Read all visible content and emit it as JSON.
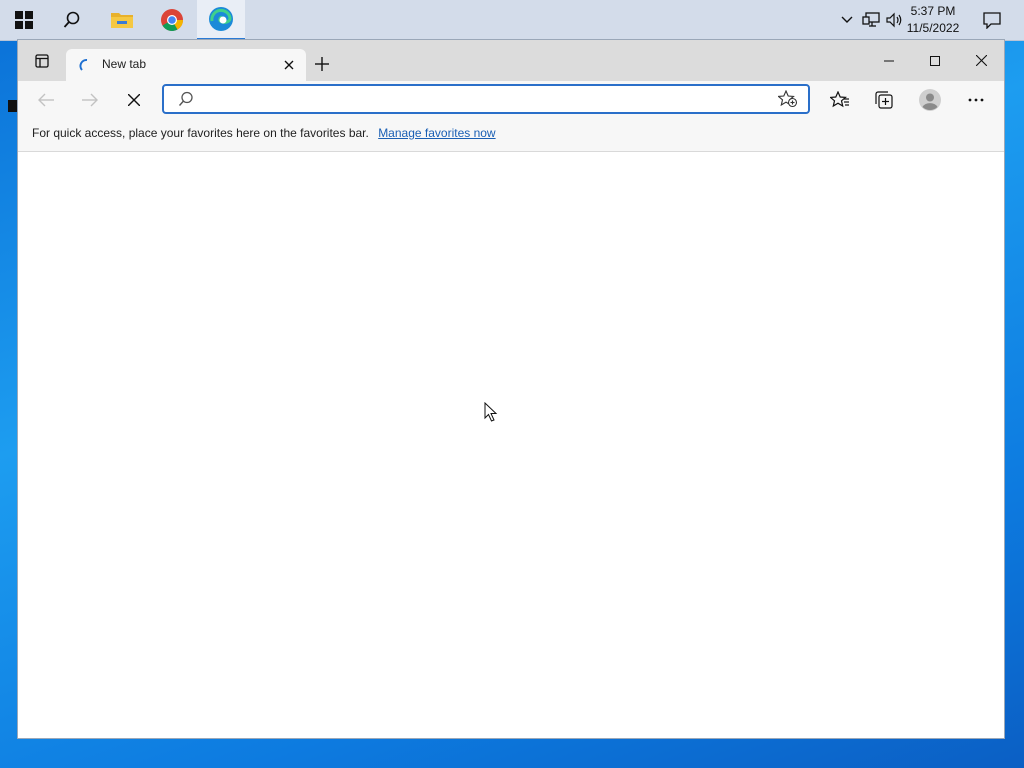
{
  "taskbar": {
    "icons": [
      "windows-start-icon",
      "search-icon",
      "file-explorer-icon",
      "chrome-icon",
      "edge-icon"
    ],
    "time": "5:37 PM",
    "date": "11/5/2022"
  },
  "browser": {
    "tab": {
      "title": "New tab"
    },
    "address": {
      "value": "",
      "placeholder": ""
    },
    "favorites_bar": {
      "message": "For quick access, place your favorites here on the favorites bar.",
      "link": "Manage favorites now"
    }
  },
  "colors": {
    "accent": "#2a6fc9",
    "taskbar": "#d3dcea",
    "link": "#1a5fb4"
  }
}
